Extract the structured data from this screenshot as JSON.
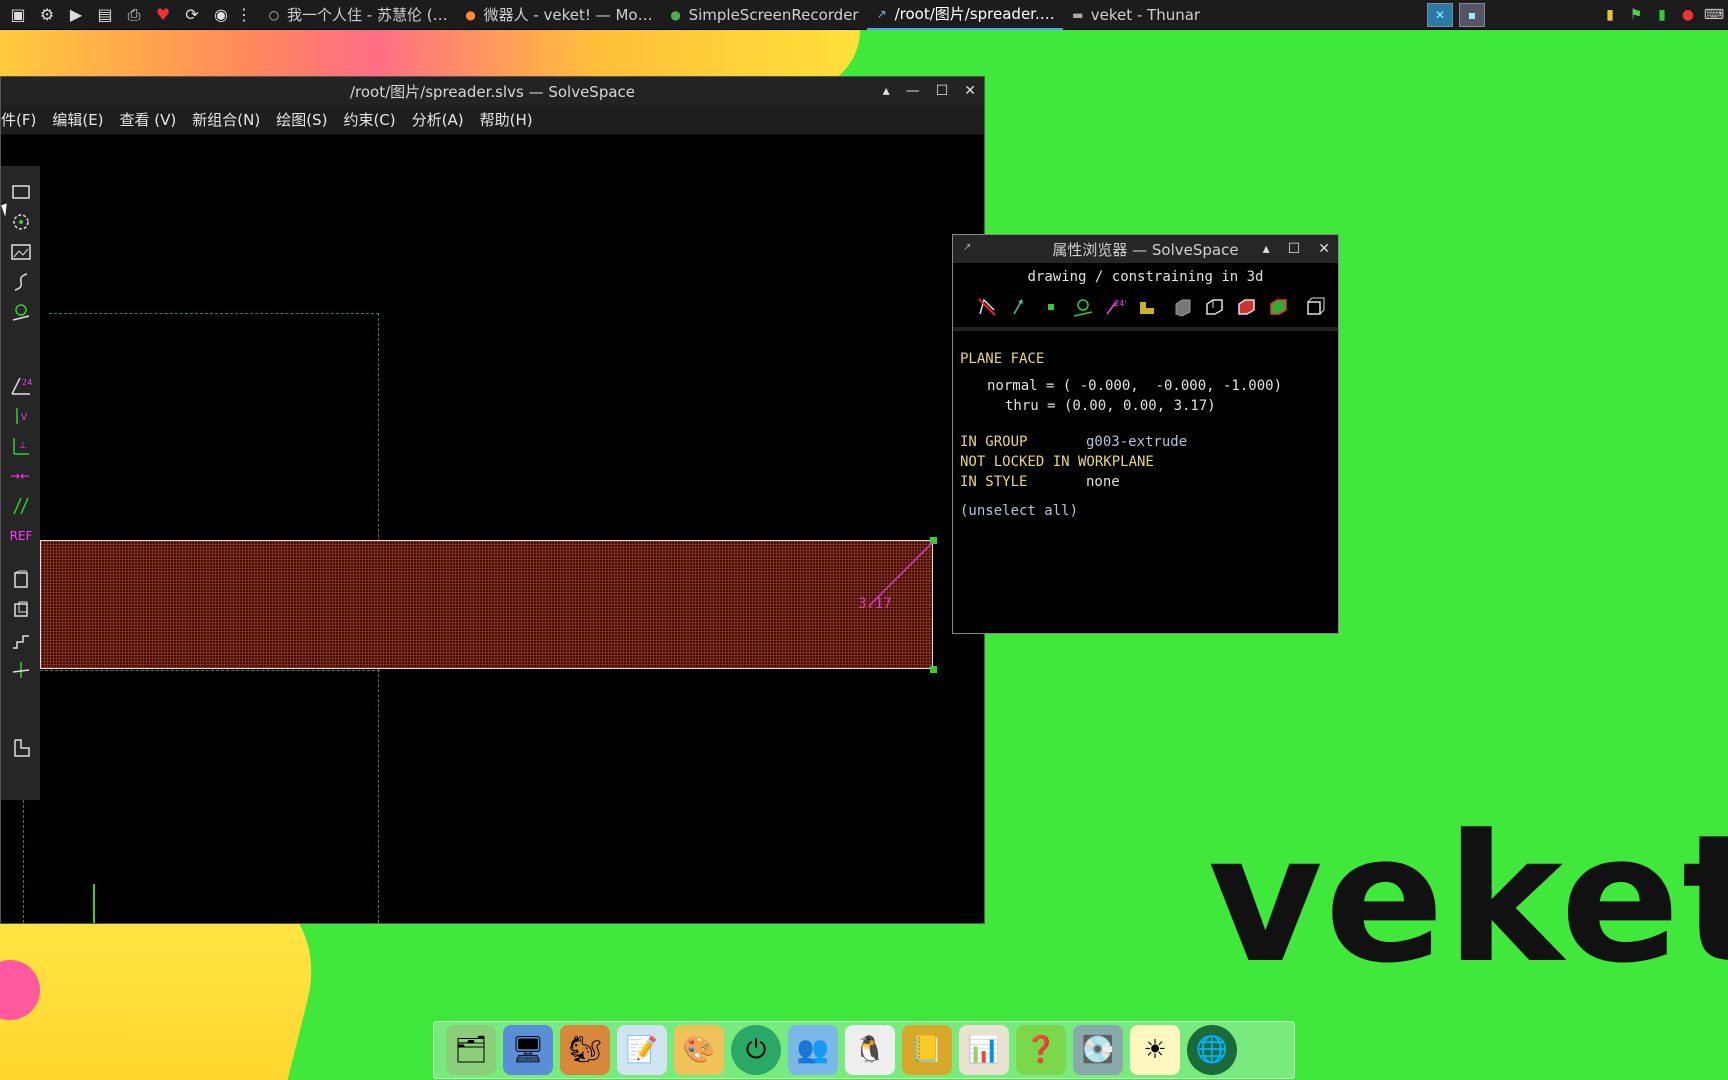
{
  "taskbar": {
    "tasks": [
      {
        "label": "我一个人住 - 苏慧伦 (…",
        "icon": "music-icon"
      },
      {
        "label": "微器人 - veket! — Mo…",
        "icon": "firefox-icon"
      },
      {
        "label": "SimpleScreenRecorder",
        "icon": "recorder-icon"
      },
      {
        "label": "/root/图片/spreader.…",
        "icon": "solvespace-icon",
        "active": true
      },
      {
        "label": "veket - Thunar",
        "icon": "folder-icon"
      }
    ]
  },
  "main_window": {
    "title": "/root/图片/spreader.slvs — SolveSpace",
    "menu": [
      "件(F)",
      "编辑(E)",
      "查看 (V)",
      "新组合(N)",
      "绘图(S)",
      "约束(C)",
      "分析(A)",
      "帮助(H)"
    ],
    "toolbar_ref_label": "REF",
    "dimension_label": "3.17"
  },
  "property_browser": {
    "title": "属性浏览器 — SolveSpace",
    "status": "drawing / constraining in 3d",
    "heading": "PLANE FACE",
    "normal_line": "normal = ( -0.000,  -0.000, -1.000)",
    "thru_line": "thru = (0.00, 0.00, 3.17)",
    "in_group_label": "IN GROUP",
    "in_group_value": "g003-extrude",
    "not_locked": "NOT LOCKED IN WORKPLANE",
    "in_style_label": "IN STYLE",
    "in_style_value": "none",
    "unselect": "(unselect all)"
  },
  "wallpaper_text": "veket",
  "colors": {
    "wallpaper_green": "#3fe83a",
    "face_fill": "#3a120a",
    "point_green": "#2fd02f",
    "dimension_magenta": "#d23cd2",
    "prop_yellow": "#e8d67a"
  }
}
